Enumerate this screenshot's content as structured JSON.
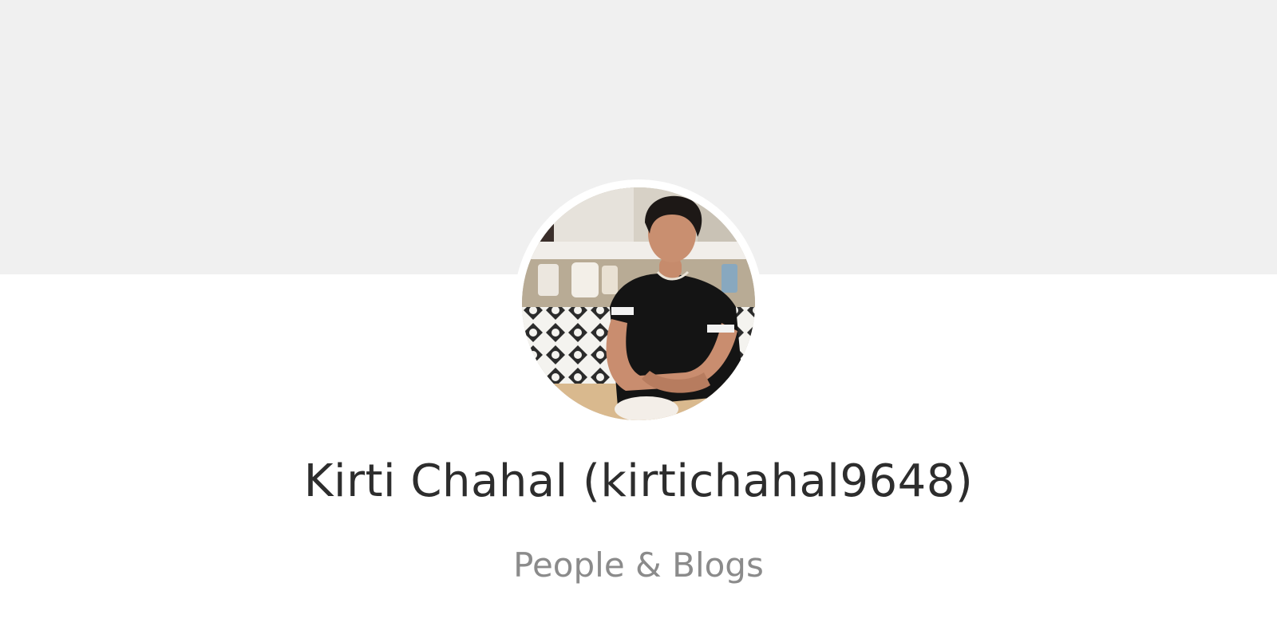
{
  "profile": {
    "display_name": "Kirti Chahal (kirtichahal9648)",
    "category": "People & Blogs",
    "avatar_alt": "Kirti Chahal"
  },
  "colors": {
    "banner": "#f0f0f0",
    "background": "#ffffff",
    "name_text": "#2d2d2d",
    "category_text": "#8b8b8b"
  }
}
